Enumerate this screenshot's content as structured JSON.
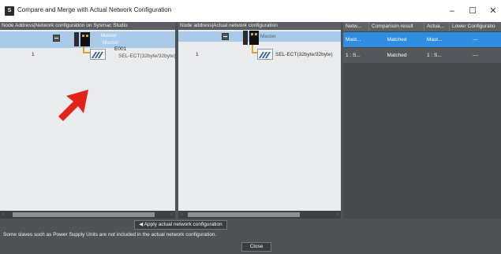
{
  "window": {
    "title": "Compare and Merge with Actual Network Configuration",
    "icon": "app-icon",
    "minimize_glyph": "–",
    "maximize_glyph": "☐",
    "close_glyph": "✕"
  },
  "left_panel": {
    "header": "Node Address|Network configuration on Sysmac Studio",
    "master_label": "Master",
    "master_sublabel": "Master",
    "slave_node": "1",
    "slave_name": "E001",
    "slave_device": "SEL-ECT(32byte/32byte)"
  },
  "middle_panel": {
    "header": "Node address|Actual network configuration",
    "master_label": "Master",
    "slave_node": "1",
    "slave_device": "SEL-ECT(32byte/32byte)"
  },
  "result_grid": {
    "headers": [
      "Netw...",
      "Comparison result",
      "Actua...",
      "Lower Configuratio"
    ],
    "rows": [
      [
        "Mast...",
        "Matched",
        "Mast...",
        "---"
      ],
      [
        "1 : S...",
        "Matched",
        "1 : S...",
        "---"
      ]
    ]
  },
  "buttons": {
    "apply": "◀ Apply actual network configuration",
    "close": "Close"
  },
  "note": "Some slaves such as Power Supply Units are not included in the actual network configuration.",
  "colors": {
    "accent_selection": "#a9cbe9",
    "selected_row": "#2f8ee0",
    "arrow": "#e2231a"
  }
}
